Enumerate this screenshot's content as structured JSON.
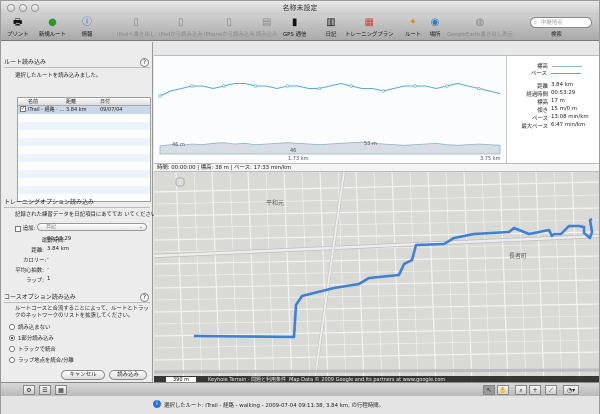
{
  "window": {
    "title": "名称未設定"
  },
  "toolbar": {
    "items": [
      {
        "label": "プリント",
        "icon": "printer-icon",
        "enabled": true
      },
      {
        "label": "新規ルート",
        "icon": "plus-icon",
        "enabled": true
      },
      {
        "label": "情報",
        "icon": "info-icon",
        "enabled": true
      },
      {
        "label": "iPodへ書き出し",
        "icon": "ipod-export-icon",
        "enabled": false
      },
      {
        "label": "iPodから読み込み",
        "icon": "ipod-import-icon",
        "enabled": false
      },
      {
        "label": "iPhoneから読み込み",
        "icon": "iphone-import-icon",
        "enabled": false
      },
      {
        "label": "読み込み",
        "icon": "import-icon",
        "enabled": false
      },
      {
        "label": "GPS 通信",
        "icon": "gps-icon",
        "enabled": true
      },
      {
        "label": "日記",
        "icon": "diary-icon",
        "enabled": true
      },
      {
        "label": "トレーニングプラン",
        "icon": "calendar-icon",
        "enabled": true
      },
      {
        "label": "ルート",
        "icon": "route-icon",
        "enabled": true
      },
      {
        "label": "場所",
        "icon": "globe-icon",
        "enabled": true
      },
      {
        "label": "GoogleEarth書き出し表示",
        "icon": "google-earth-icon",
        "enabled": false
      }
    ],
    "search_placeholder": "中継地点",
    "search_label": "検索"
  },
  "route_import": {
    "header": "ルート読み込み",
    "instruction": "選択したルートを読み込みました。",
    "columns": [
      "名前",
      "距離",
      "日付"
    ],
    "rows": [
      {
        "checked": true,
        "name": "iTrail - 経路 · ...",
        "distance": "3.84 km",
        "date": "09/07/04"
      }
    ]
  },
  "training_import": {
    "header": "トレーニングオプション読み込み",
    "instruction": "記録された練習データを日記項目にあててお いてください。",
    "add_label": "追加:",
    "add_select": "日記",
    "fields": [
      {
        "label": "運動時間:",
        "value": "00:53:29"
      },
      {
        "label": "距離:",
        "value": "3.84 km"
      },
      {
        "label": "カロリー:",
        "value": "-"
      },
      {
        "label": "平均心拍数:",
        "value": "-"
      },
      {
        "label": "ラップ:",
        "value": "1"
      }
    ]
  },
  "course_import": {
    "header": "コースオプション読み込み",
    "instruction": "ルートコースと合流することによって、ルートとトラックのネットワークのリストを拡張してください。",
    "options": [
      {
        "label": "読み込まない",
        "selected": false
      },
      {
        "label": "1部分読み込み",
        "selected": true
      },
      {
        "label": "トラックで統合",
        "selected": false
      },
      {
        "label": "ラップ地点を統合/分離",
        "selected": false
      }
    ]
  },
  "buttons": {
    "cancel": "キャンセル",
    "import": "読み込み"
  },
  "chart_data": {
    "type": "line",
    "series": [
      {
        "name": "標高",
        "color": "#8fb7c9",
        "values": [
          42,
          44,
          43,
          45,
          44,
          46,
          47,
          45,
          46,
          44,
          45,
          46,
          47,
          46,
          45,
          44,
          45,
          46,
          47,
          48,
          46,
          45,
          44,
          43,
          44,
          45,
          46,
          44,
          43,
          44,
          45,
          44,
          43
        ]
      },
      {
        "name": "ペース",
        "color": "#5aa9d6",
        "values": [
          8,
          10,
          11,
          12,
          12,
          11,
          12,
          13,
          13,
          12,
          12,
          11,
          12,
          12,
          11,
          11,
          12,
          13,
          12,
          11,
          11,
          10,
          11,
          12,
          12,
          12,
          11,
          12,
          13,
          12,
          11,
          10,
          9
        ]
      }
    ],
    "annotations": [
      "46 m",
      "46",
      "53 m",
      "1.73 km",
      "3.75 km"
    ],
    "hover_status": "時間: 00:00:00 | 標高: 38 m | ペース: 17:33 min/km"
  },
  "stats_legend": {
    "series": [
      {
        "label": "標高",
        "color": "#8fb7c9"
      },
      {
        "label": "ペース",
        "color": "#5aa9d6"
      }
    ],
    "stats": [
      {
        "label": "距離",
        "value": "3.84 km"
      },
      {
        "label": "経過時間",
        "value": "00:53:29"
      },
      {
        "label": "標高",
        "value": "17 m"
      },
      {
        "label": "傾き",
        "value": "15 m/0 m"
      },
      {
        "label": "ペース",
        "value": "13:08 min/km"
      },
      {
        "label": "最大ペース",
        "value": "6:47 min/km"
      }
    ]
  },
  "map": {
    "scale": "390 m",
    "attribution_links": "Keyhole Terrain · 問題と利用条件",
    "copyright": "Map Data © 2009 Google and its partners at www.google.com",
    "labels": [
      "平和元",
      "長者町"
    ]
  },
  "status_bar": {
    "text": "選択したルート: iTrail - 経路 - walking - 2009-07-04 09:11:38, 3.84 km, の行程時間。"
  }
}
